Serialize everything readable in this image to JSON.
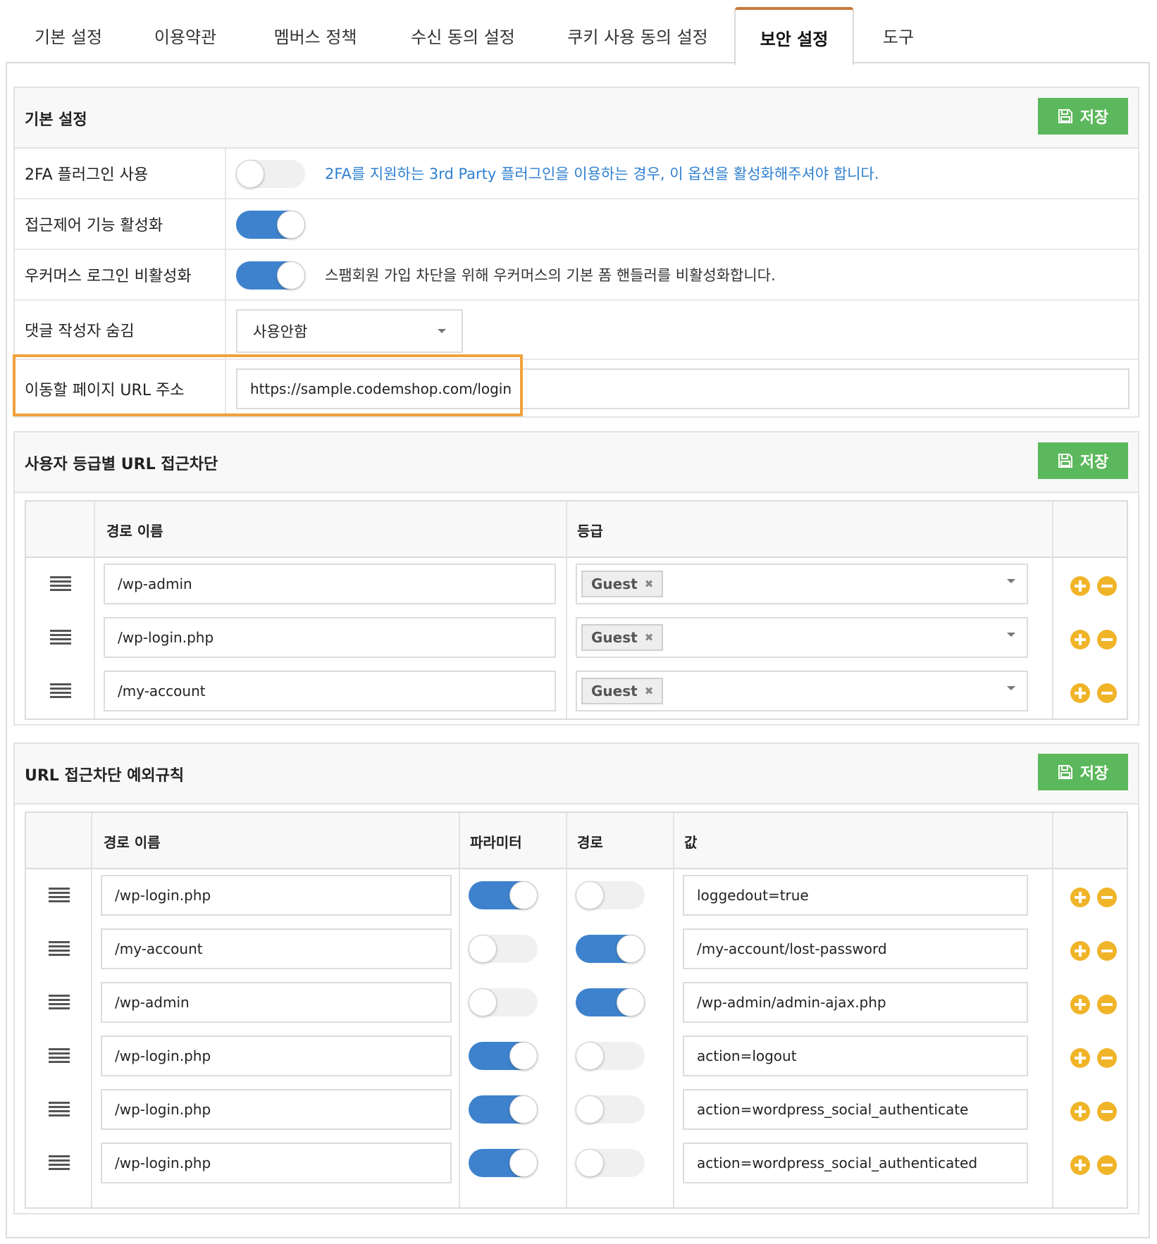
{
  "tabs": [
    {
      "label": "기본 설정"
    },
    {
      "label": "이용약관"
    },
    {
      "label": "멤버스 정책"
    },
    {
      "label": "수신 동의 설정"
    },
    {
      "label": "쿠키 사용 동의 설정"
    },
    {
      "label": "보안 설정"
    },
    {
      "label": "도구"
    }
  ],
  "active_tab": "보안 설정",
  "colors": {
    "accent_tab": "#c97a3c",
    "save_button": "#5cb85c",
    "toggle_on": "#3e82cd",
    "link_text": "#2f80d1",
    "highlight": "#f0a23c",
    "row_action": "#f0b429"
  },
  "icons": {
    "save": "floppy-disk-icon",
    "drag": "drag-handle-icon",
    "add": "plus-circle-icon",
    "remove": "minus-circle-icon",
    "dropdown": "caret-down-icon",
    "tag_remove": "close-x-icon"
  },
  "basic": {
    "title": "기본 설정",
    "save_label": "저장",
    "rows": {
      "twofa": {
        "label": "2FA 플러그인 사용",
        "on": false,
        "desc": "2FA를 지원하는 3rd Party 플러그인을 이용하는 경우, 이 옵션을 활성화해주셔야 합니다."
      },
      "access": {
        "label": "접근제어 기능 활성화",
        "on": true
      },
      "woo": {
        "label": "우커머스 로그인 비활성화",
        "on": true,
        "desc": "스팸회원 가입 차단을 위해 우커머스의 기본 폼 핸들러를 비활성화합니다."
      },
      "hide": {
        "label": "댓글 작성자 숨김",
        "value": "사용안함"
      },
      "redirect": {
        "label": "이동할 페이지 URL 주소",
        "value": "https://sample.codemshop.com/login"
      }
    }
  },
  "grade": {
    "title": "사용자 등급별 URL 접근차단",
    "save_label": "저장",
    "headers": {
      "path": "경로 이름",
      "grade": "등급"
    },
    "rows": [
      {
        "path": "/wp-admin",
        "grade": "Guest"
      },
      {
        "path": "/wp-login.php",
        "grade": "Guest"
      },
      {
        "path": "/my-account",
        "grade": "Guest"
      }
    ]
  },
  "exceptions": {
    "title": "URL 접근차단 예외규칙",
    "save_label": "저장",
    "headers": {
      "path": "경로 이름",
      "param": "파라미터",
      "route": "경로",
      "value": "값"
    },
    "rows": [
      {
        "path": "/wp-login.php",
        "param": true,
        "route": false,
        "value": "loggedout=true"
      },
      {
        "path": "/my-account",
        "param": false,
        "route": true,
        "value": "/my-account/lost-password"
      },
      {
        "path": "/wp-admin",
        "param": false,
        "route": true,
        "value": "/wp-admin/admin-ajax.php"
      },
      {
        "path": "/wp-login.php",
        "param": true,
        "route": false,
        "value": "action=logout"
      },
      {
        "path": "/wp-login.php",
        "param": true,
        "route": false,
        "value": "action=wordpress_social_authenticate"
      },
      {
        "path": "/wp-login.php",
        "param": true,
        "route": false,
        "value": "action=wordpress_social_authenticated"
      }
    ]
  }
}
